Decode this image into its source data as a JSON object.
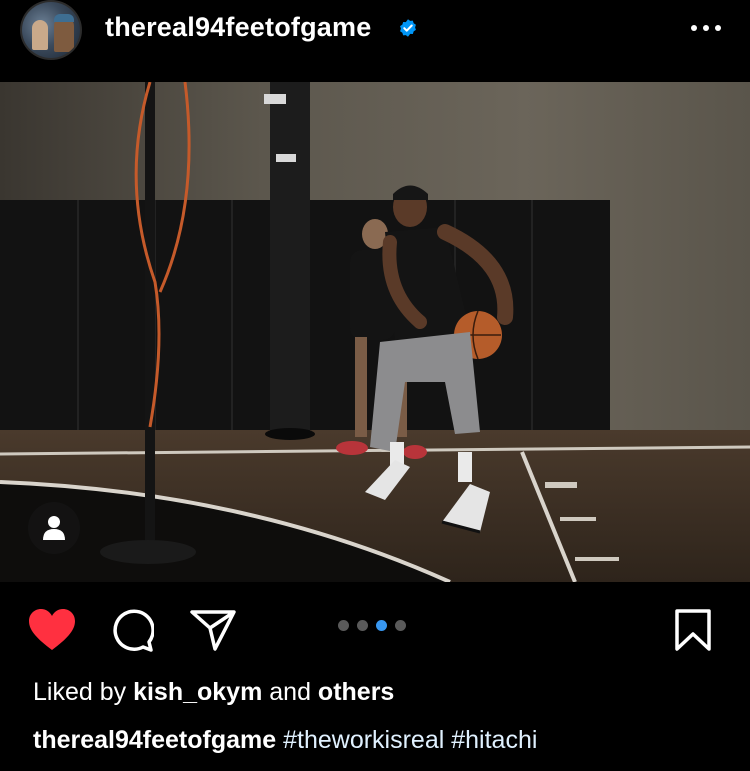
{
  "post": {
    "username": "thereal94feetofgame",
    "verified_icon": "verified-badge-icon",
    "more_icon": "more-options-icon"
  },
  "media": {
    "carousel_count": 4,
    "carousel_active_index": 2
  },
  "actions": {
    "like_icon": "heart-filled-icon",
    "like_color": "#ff3040",
    "comment_icon": "comment-icon",
    "share_icon": "send-icon",
    "save_icon": "bookmark-icon",
    "carousel_active_color": "#3897f0"
  },
  "likes": {
    "prefix": "Liked by ",
    "user": "kish_okym",
    "connector": " and ",
    "others": "others"
  },
  "caption": {
    "username": "thereal94feetofgame",
    "hashtags": [
      "#theworkisreal",
      "#hitachi"
    ]
  }
}
